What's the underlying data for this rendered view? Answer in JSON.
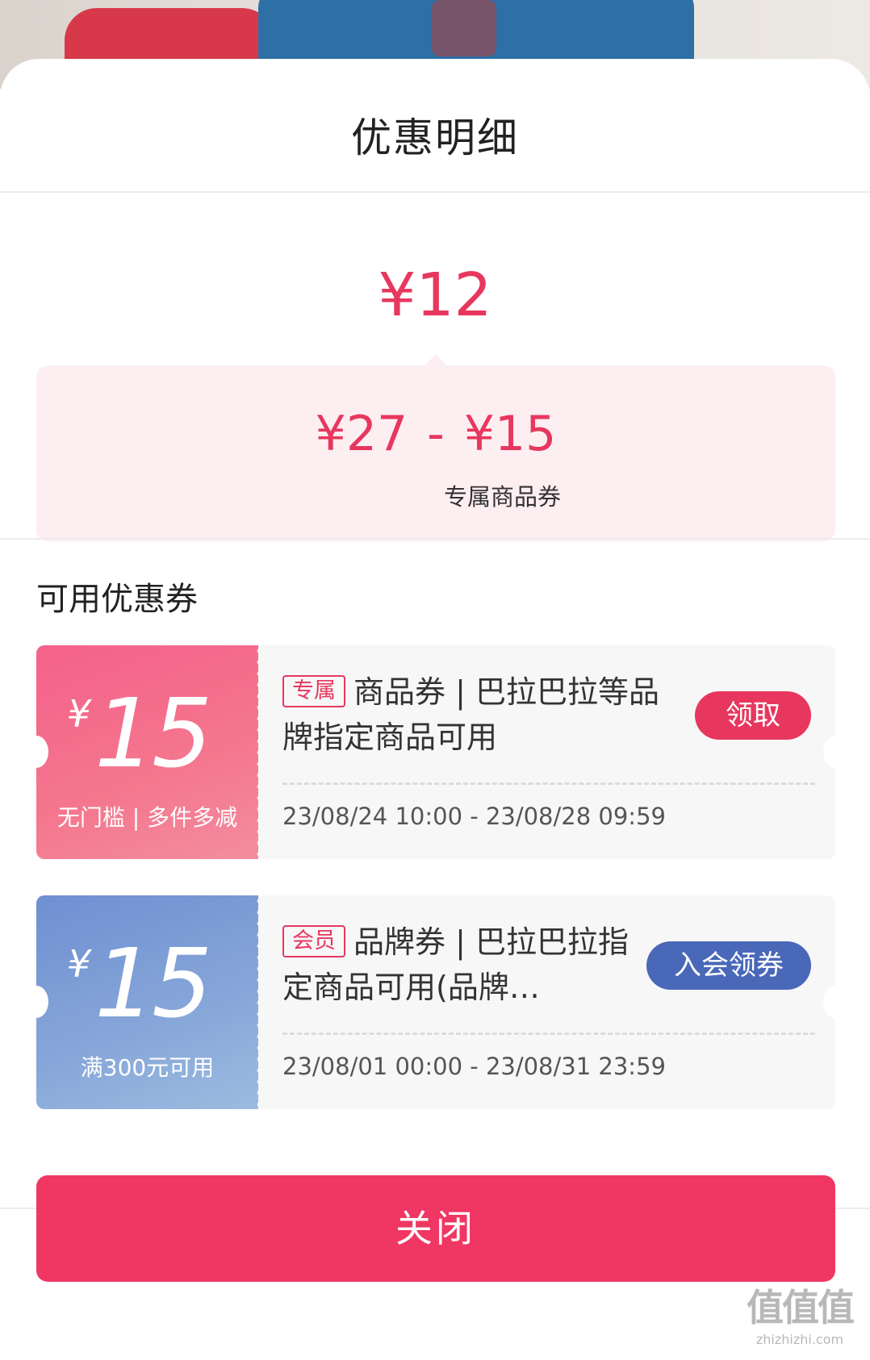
{
  "sheet": {
    "title": "优惠明细"
  },
  "summary": {
    "total": "¥12",
    "original_price": "¥27",
    "minus": "-",
    "discount": "¥15",
    "discount_label": "专属商品券"
  },
  "coupons_section": {
    "title": "可用优惠券"
  },
  "coupons": [
    {
      "currency": "¥",
      "amount": "15",
      "condition": "无门槛 | 多件多减",
      "tag": "专属",
      "description": "商品券 | 巴拉巴拉等品牌指定商品可用",
      "validity": "23/08/24 10:00 - 23/08/28 09:59",
      "action": "领取"
    },
    {
      "currency": "¥",
      "amount": "15",
      "condition": "满300元可用",
      "tag": "会员",
      "description": "品牌券 | 巴拉巴拉指定商品可用(品牌…",
      "validity": "23/08/01 00:00 - 23/08/31 23:59",
      "action": "入会领券"
    }
  ],
  "footer": {
    "close_label": "关闭"
  },
  "watermark": {
    "logo": "值值值",
    "url": "zhizhizhi.com"
  }
}
